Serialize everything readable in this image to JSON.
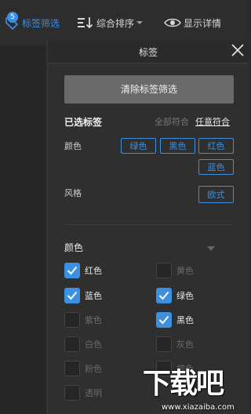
{
  "toolbar": {
    "filter_label": "标签筛选",
    "filter_badge": "5",
    "sort_label": "综合排序",
    "detail_label": "显示详情"
  },
  "panel": {
    "title": "标签",
    "clear_button": "清除标签筛选",
    "selected_title": "已选标签",
    "match_all": "全部符合",
    "match_any": "任意符合",
    "selected_groups": [
      {
        "label": "颜色",
        "tags": [
          "绿色",
          "黑色",
          "红色",
          "蓝色"
        ]
      },
      {
        "label": "风格",
        "tags": [
          "欧式"
        ]
      }
    ],
    "color_section": {
      "title": "颜色",
      "options": [
        {
          "label": "红色",
          "checked": true
        },
        {
          "label": "黄色",
          "checked": false
        },
        {
          "label": "蓝色",
          "checked": true
        },
        {
          "label": "绿色",
          "checked": true
        },
        {
          "label": "紫色",
          "checked": false
        },
        {
          "label": "黑色",
          "checked": true
        },
        {
          "label": "白色",
          "checked": false
        },
        {
          "label": "灰色",
          "checked": false
        },
        {
          "label": "粉色",
          "checked": false
        },
        {
          "label": "棕色",
          "checked": false
        },
        {
          "label": "透明",
          "checked": false
        }
      ]
    }
  },
  "watermark": {
    "brand": "下载吧",
    "url": "www.xiazaiba.com"
  },
  "colors": {
    "accent": "#3d8fe0",
    "background": "#2b2b2b",
    "panel": "#2f2f2f"
  },
  "icons": {
    "filter": "tag-filter-icon",
    "sort": "sort-icon",
    "detail": "eye-icon",
    "close": "close-icon",
    "check": "checkmark-icon"
  }
}
